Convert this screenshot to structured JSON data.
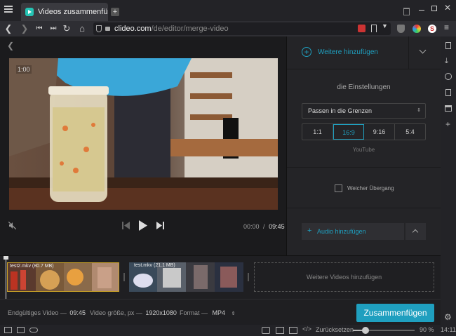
{
  "tab": {
    "title": "Videos zusammenfügen o"
  },
  "address": {
    "domain": "clideo.com",
    "path": "/de/editor/merge-video"
  },
  "player": {
    "badge": "1:00",
    "current_time": "00:00",
    "separator": "/",
    "total_time": "09:45"
  },
  "panel": {
    "add_more": "Weitere hinzufügen",
    "settings_title": "die Einstellungen",
    "fit_option": "Passen in die Grenzen",
    "ratios": [
      "1:1",
      "16:9",
      "9:16",
      "5:4"
    ],
    "selected_ratio": "16:9",
    "ratio_caption": "YouTube",
    "crossfade_label": "Weicher Übergang",
    "add_audio": "Audio hinzufügen"
  },
  "timeline": {
    "clips": [
      {
        "name": "test2.mkv (80.7 MB)"
      },
      {
        "name": "test.mkv (21.1 MB)"
      }
    ],
    "add_videos": "Weitere Videos hinzufügen"
  },
  "footer": {
    "final_label": "Endgültiges Video —",
    "final_value": "09:45",
    "size_label": "Video größe, px —",
    "size_value": "1920x1080",
    "format_label": "Format —",
    "format_value": "MP4",
    "merge_button": "Zusammenfügen"
  },
  "statusbar": {
    "reset": "Zurücksetzen",
    "zoom": "90 %",
    "zoom_level": 0.9,
    "time": "14:11"
  },
  "colors": {
    "accent": "#1f9fbf",
    "selected_ratio": "#1f9fbf"
  }
}
